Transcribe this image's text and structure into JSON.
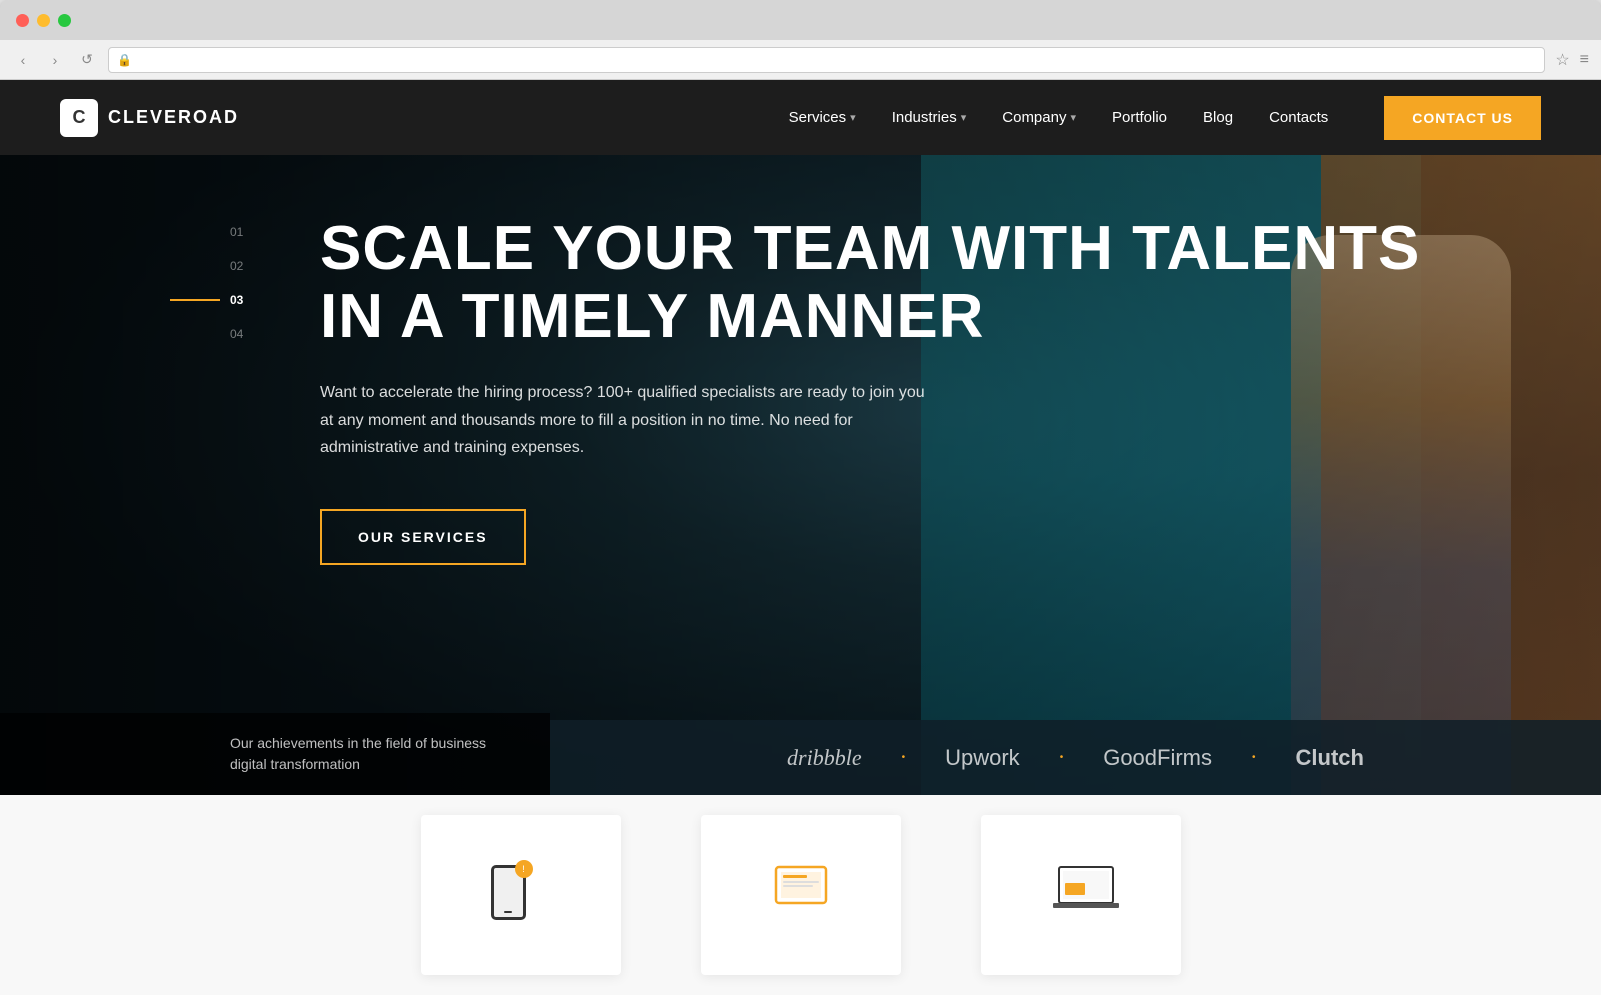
{
  "browser": {
    "dots": [
      "red",
      "yellow",
      "green"
    ],
    "nav_back": "‹",
    "nav_forward": "›",
    "nav_refresh": "↺",
    "lock_icon": "🔒",
    "address": "",
    "bookmark": "☆",
    "menu": "≡"
  },
  "navbar": {
    "logo_letter": "C",
    "logo_text": "CLEVEROAD",
    "links": [
      {
        "label": "Services",
        "has_dropdown": true
      },
      {
        "label": "Industries",
        "has_dropdown": true
      },
      {
        "label": "Company",
        "has_dropdown": true
      },
      {
        "label": "Portfolio",
        "has_dropdown": false
      },
      {
        "label": "Blog",
        "has_dropdown": false
      },
      {
        "label": "Contacts",
        "has_dropdown": false
      }
    ],
    "cta_label": "CONTACT US"
  },
  "hero": {
    "slide_numbers": [
      "01",
      "02",
      "03",
      "04"
    ],
    "active_slide": 2,
    "title_line1": "SCALE YOUR TEAM WITH TALENTS",
    "title_line2": "IN A TIMELY MANNER",
    "subtitle": "Want to accelerate the hiring process? 100+ qualified specialists are ready to join you at any moment and thousands more to fill a position in no time. No need for administrative and training expenses.",
    "cta_label": "OUR SERVICES",
    "achievements_label": "Our achievements in the field of business digital transformation",
    "brands": [
      "dribbble",
      "Upwork",
      "GoodFirms",
      "Clutch"
    ],
    "brand_dots": [
      "•",
      "•",
      "•"
    ]
  },
  "colors": {
    "accent": "#f5a623",
    "nav_bg": "#0a0a0a",
    "hero_bg": "#1e3040",
    "teal": "#1a7a85"
  }
}
